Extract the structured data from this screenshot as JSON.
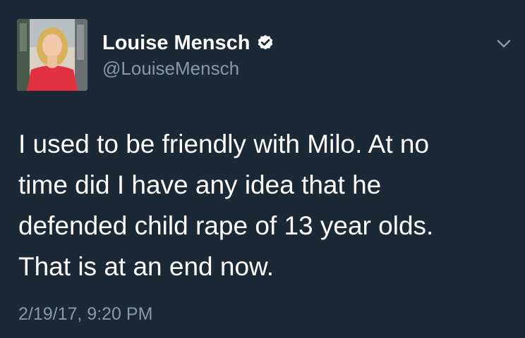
{
  "tweet": {
    "author": {
      "display_name": "Louise Mensch",
      "handle": "@LouiseMensch",
      "verified": true,
      "avatar_icon": "profile-photo"
    },
    "text_lines": [
      "I used to be friendly with Milo. At no",
      "time did I have any idea that he",
      "defended child rape of 13 year olds.",
      "That is at an end now."
    ],
    "timestamp": "2/19/17, 9:20 PM",
    "menu_icon": "chevron-down-icon"
  },
  "colors": {
    "background": "#1b2836",
    "primary_text": "#ffffff",
    "secondary_text": "#8899a6",
    "verified_badge": "#ffffff"
  }
}
